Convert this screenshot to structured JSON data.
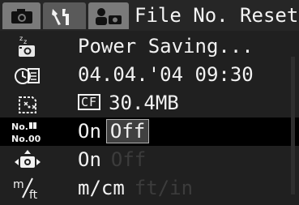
{
  "tabs": {
    "camera_icon": "camera-icon",
    "setup_icon": "setup-tools-icon",
    "mymenu_icon": "my-camera-icon",
    "active_label": "File No. Reset"
  },
  "menu": [
    {
      "icon": "power-saving-icon",
      "label": "Power Saving..."
    },
    {
      "icon": "date-time-icon",
      "label": "04.04.'04 09:30"
    },
    {
      "icon": "format-card-icon",
      "badge": "CF",
      "label": "30.4MB"
    },
    {
      "icon": "file-number-reset-icon",
      "option_on": "On",
      "option_off": "Off",
      "selected": "Off"
    },
    {
      "icon": "auto-rotate-icon",
      "option_on": "On",
      "option_off": "Off",
      "selected": "On"
    },
    {
      "icon": "distance-units-icon",
      "option_a": "m/cm",
      "option_b": "ft/in",
      "selected": "m/cm"
    }
  ],
  "colors": {
    "background": "#202020",
    "tab": "#7a7a7a",
    "highlight_row": "#000000"
  }
}
